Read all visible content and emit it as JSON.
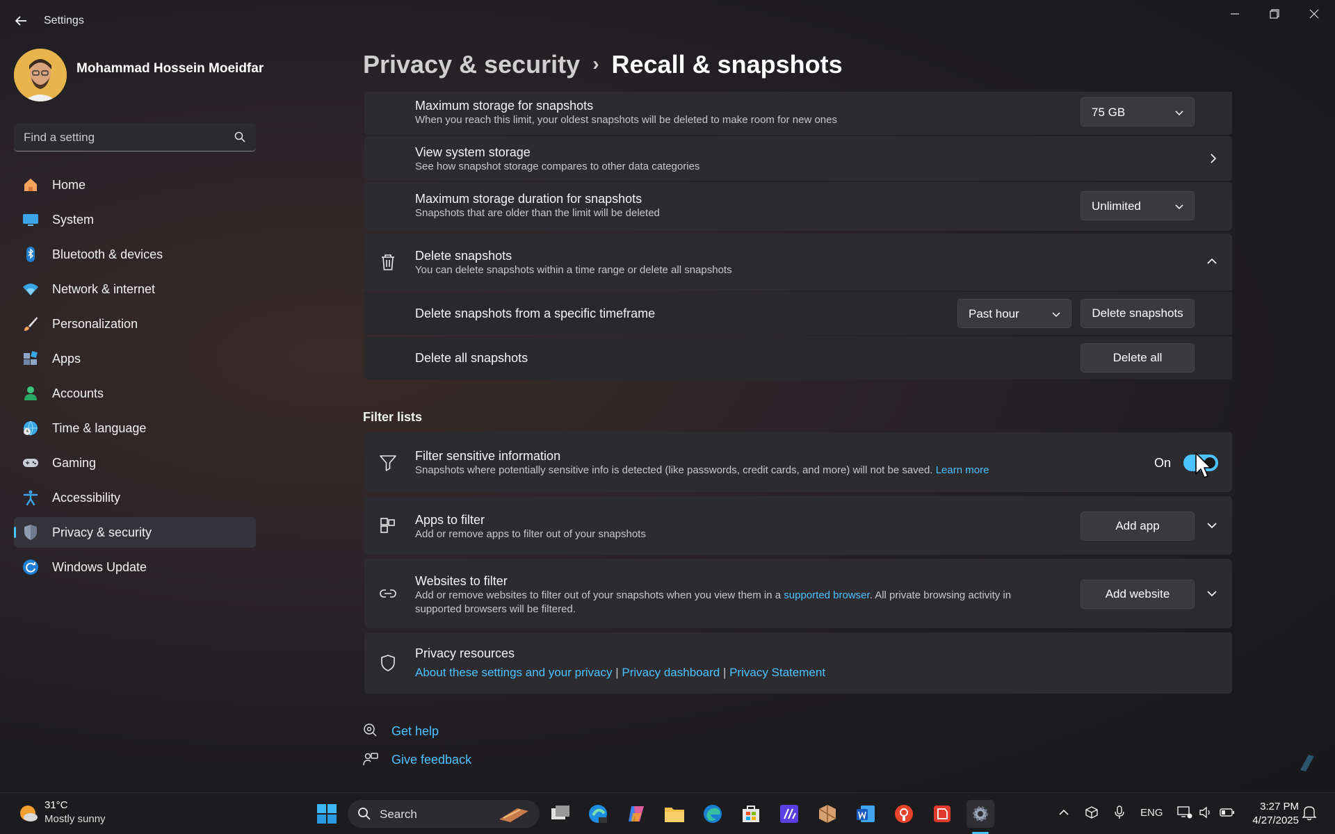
{
  "app": {
    "title": "Settings"
  },
  "user": {
    "name": "Mohammad Hossein Moeidfar"
  },
  "search": {
    "placeholder": "Find a setting"
  },
  "sidebar": {
    "items": [
      {
        "label": "Home",
        "icon": "home-icon"
      },
      {
        "label": "System",
        "icon": "system-icon"
      },
      {
        "label": "Bluetooth & devices",
        "icon": "bluetooth-icon"
      },
      {
        "label": "Network & internet",
        "icon": "wifi-icon"
      },
      {
        "label": "Personalization",
        "icon": "brush-icon"
      },
      {
        "label": "Apps",
        "icon": "apps-icon"
      },
      {
        "label": "Accounts",
        "icon": "accounts-icon"
      },
      {
        "label": "Time & language",
        "icon": "globe-clock-icon"
      },
      {
        "label": "Gaming",
        "icon": "gamepad-icon"
      },
      {
        "label": "Accessibility",
        "icon": "accessibility-icon"
      },
      {
        "label": "Privacy & security",
        "icon": "shield-icon",
        "active": true
      },
      {
        "label": "Windows Update",
        "icon": "update-icon"
      }
    ]
  },
  "breadcrumb": {
    "parent": "Privacy & security",
    "separator": "›",
    "current": "Recall & snapshots"
  },
  "storage": {
    "max_title": "Maximum storage for snapshots",
    "max_desc": "When you reach this limit, your oldest snapshots will be deleted to make room for new ones",
    "max_value": "75 GB",
    "view_title": "View system storage",
    "view_desc": "See how snapshot storage compares to other data categories",
    "duration_title": "Maximum storage duration for snapshots",
    "duration_desc": "Snapshots that are older than the limit will be deleted",
    "duration_value": "Unlimited"
  },
  "delete": {
    "title": "Delete snapshots",
    "desc": "You can delete snapshots within a time range or delete all snapshots",
    "timeframe_label": "Delete snapshots from a specific timeframe",
    "timeframe_value": "Past hour",
    "timeframe_button": "Delete snapshots",
    "all_label": "Delete all snapshots",
    "all_button": "Delete all"
  },
  "filters": {
    "section_title": "Filter lists",
    "sensitive_title": "Filter sensitive information",
    "sensitive_desc": "Snapshots where potentially sensitive info is detected (like passwords, credit cards, and more) will not be saved.",
    "sensitive_link": "Learn more",
    "sensitive_state": "On",
    "apps_title": "Apps to filter",
    "apps_desc": "Add or remove apps to filter out of your snapshots",
    "apps_button": "Add app",
    "websites_title": "Websites to filter",
    "websites_desc_1": "Add or remove websites to filter out of your snapshots when you view them in a",
    "websites_link": "supported browser",
    "websites_desc_2": ". All private browsing activity in",
    "websites_desc_3": "supported browsers will be filtered.",
    "websites_button": "Add website"
  },
  "privacy_resources": {
    "title": "Privacy resources",
    "link1": "About these settings and your privacy",
    "link2": "Privacy dashboard",
    "link3": "Privacy Statement",
    "divider": "|"
  },
  "help": {
    "get_help": "Get help",
    "give_feedback": "Give feedback"
  },
  "taskbar": {
    "weather_temp": "31°C",
    "weather_desc": "Mostly sunny",
    "search_label": "Search",
    "language": "ENG",
    "time": "3:27 PM",
    "date": "4/27/2025"
  },
  "colors": {
    "accent": "#4cc2ff",
    "background": "#1f1d22",
    "card": "#2c2b30"
  }
}
